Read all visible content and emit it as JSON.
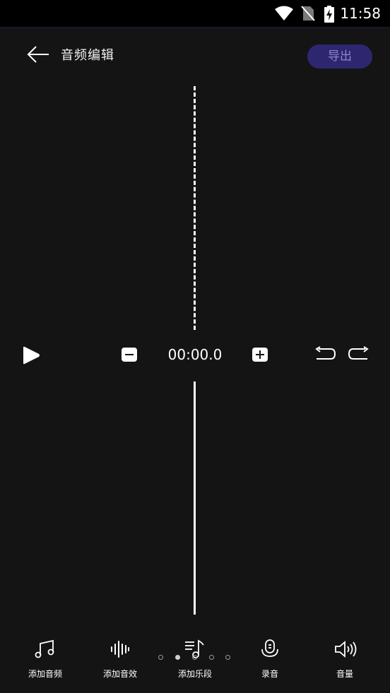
{
  "status_bar": {
    "time": "11:58",
    "icons": [
      "wifi-icon",
      "no-sim-icon",
      "battery-charging-icon"
    ]
  },
  "header": {
    "title": "音频编辑",
    "back_icon": "arrow-left-icon",
    "export_label": "导出"
  },
  "colors": {
    "background": "#141414",
    "export_button_bg": "#2e2770",
    "export_button_text": "#8e86c8"
  },
  "playback": {
    "time": "00:00.0",
    "play_icon": "play-icon",
    "minus_icon": "minus-icon",
    "plus_icon": "plus-icon",
    "undo_icon": "undo-icon",
    "redo_icon": "redo-icon"
  },
  "toolbar": {
    "items": [
      {
        "label": "添加音频",
        "icon": "music-note-icon"
      },
      {
        "label": "添加音效",
        "icon": "sound-wave-icon"
      },
      {
        "label": "添加乐段",
        "icon": "music-list-icon"
      },
      {
        "label": "录音",
        "icon": "microphone-icon"
      },
      {
        "label": "音量",
        "icon": "volume-icon"
      }
    ]
  },
  "pagination": {
    "count": 5,
    "active_index": 1
  }
}
